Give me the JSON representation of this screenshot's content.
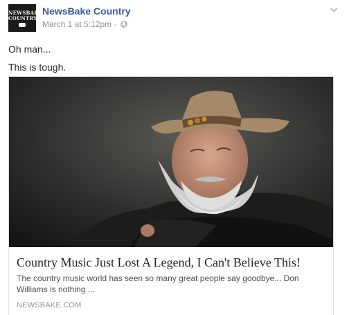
{
  "post": {
    "page_name": "NewsBake Country",
    "avatar": {
      "line1": "NEWSBAKE",
      "line2": "COUNTRY"
    },
    "timestamp": "March 1 at 5:12pm",
    "separator": "·",
    "privacy_icon": "globe-icon",
    "menu_icon": "chevron-down-icon",
    "message_lines": [
      "Oh man...",
      "This is tough."
    ]
  },
  "link_card": {
    "title": "Country Music Just Lost A Legend, I Can't Believe This!",
    "description": "The country music world has seen so many great people say goodbye... Don Williams is nothing ...",
    "domain": "NEWSBAKE.COM"
  },
  "colors": {
    "link_blue": "#365899",
    "meta_gray": "#90949c",
    "card_border": "#dddfe2",
    "hat_tan": "#a58a6a"
  }
}
